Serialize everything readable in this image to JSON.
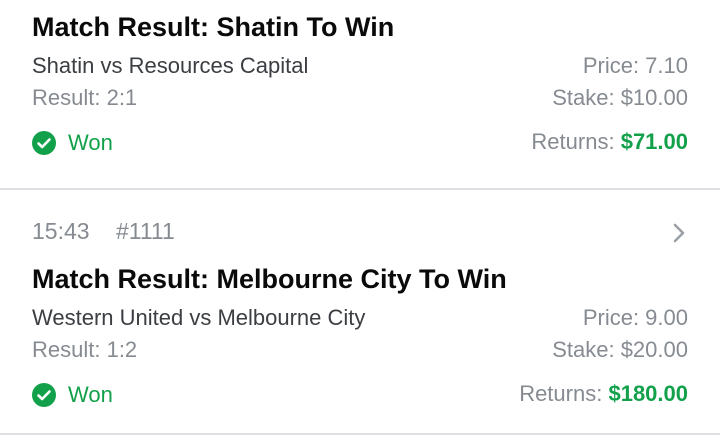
{
  "colors": {
    "won_green": "#12a14a",
    "muted_text": "#868b92",
    "divider": "#dedfe3"
  },
  "bets": [
    {
      "market_title": "Match Result: Shatin To Win",
      "event": "Shatin vs Resources Capital",
      "result": "Result: 2:1",
      "price": "Price: 7.10",
      "stake": "Stake: $10.00",
      "status": "Won",
      "status_icon": "check-circle-icon",
      "returns_label": "Returns:",
      "returns_value": "$71.00"
    },
    {
      "time": "15:43",
      "bet_id": "#1111",
      "market_title": "Match Result: Melbourne City To Win",
      "event": "Western United vs Melbourne City",
      "result": "Result: 1:2",
      "price": "Price: 9.00",
      "stake": "Stake: $20.00",
      "status": "Won",
      "status_icon": "check-circle-icon",
      "returns_label": "Returns:",
      "returns_value": "$180.00"
    }
  ]
}
